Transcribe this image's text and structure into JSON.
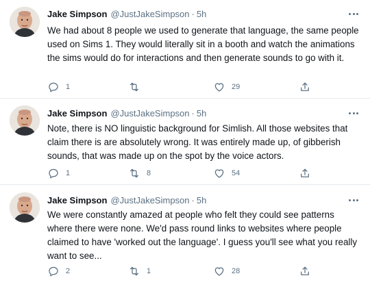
{
  "tweets": [
    {
      "name": "Jake Simpson",
      "handle": "@JustJakeSimpson",
      "dot": "·",
      "time": "5h",
      "text": "We had about 8 people we used to generate that language, the same people used on Sims 1. They would literally sit in a booth and watch the animations the sims would do for interactions and then generate sounds to go with it.",
      "replies": "1",
      "retweets": "",
      "likes": "29"
    },
    {
      "name": "Jake Simpson",
      "handle": "@JustJakeSimpson",
      "dot": "·",
      "time": "5h",
      "text": "Note, there is NO linguistic background for Simlish. All those websites that claim there is are absolutely wrong. It was entirely made up, of gibberish sounds, that was made up on the spot by the voice actors.",
      "replies": "1",
      "retweets": "8",
      "likes": "54"
    },
    {
      "name": "Jake Simpson",
      "handle": "@JustJakeSimpson",
      "dot": "·",
      "time": "5h",
      "text": "We were constantly amazed at people who felt they could see patterns where there were none. We'd pass round links to websites where people claimed to have 'worked out the language'. I guess you'll see what you really want to see...",
      "replies": "2",
      "retweets": "1",
      "likes": "28"
    }
  ],
  "icons": {
    "reply": "reply-icon",
    "retweet": "retweet-icon",
    "like": "heart-icon",
    "share": "share-icon",
    "more": "more-icon"
  },
  "colors": {
    "text": "#0f1419",
    "secondary": "#5b7083",
    "divider": "#e6ecf0"
  }
}
